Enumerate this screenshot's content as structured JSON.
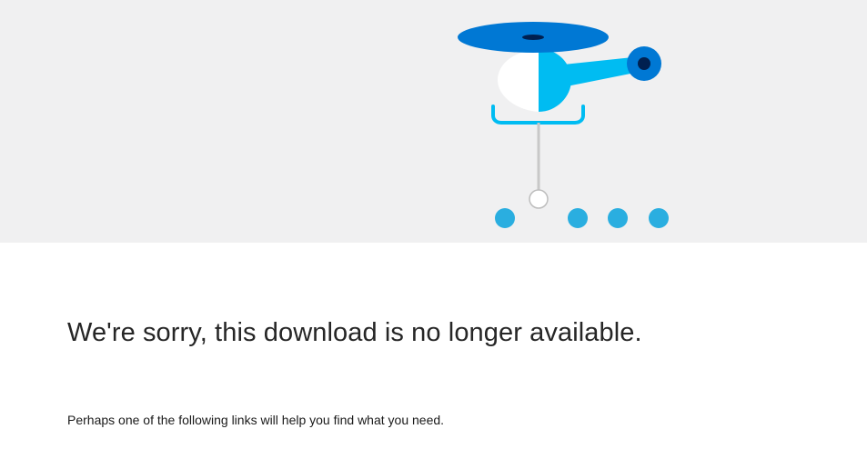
{
  "illustration": {
    "icon": "helicopter-icon",
    "colors": {
      "background": "#f0f0f1",
      "rotor": "#0078d4",
      "body_light": "#00bcf2",
      "body_white": "#ffffff",
      "tail_rotor": "#0078d4",
      "tail_hub": "#002050",
      "rope": "#c8c8c8",
      "dot": "#2aaee0"
    }
  },
  "message": {
    "title": "We're sorry, this download is no longer available.",
    "subtitle": "Perhaps one of the following links will help you find what you need."
  }
}
